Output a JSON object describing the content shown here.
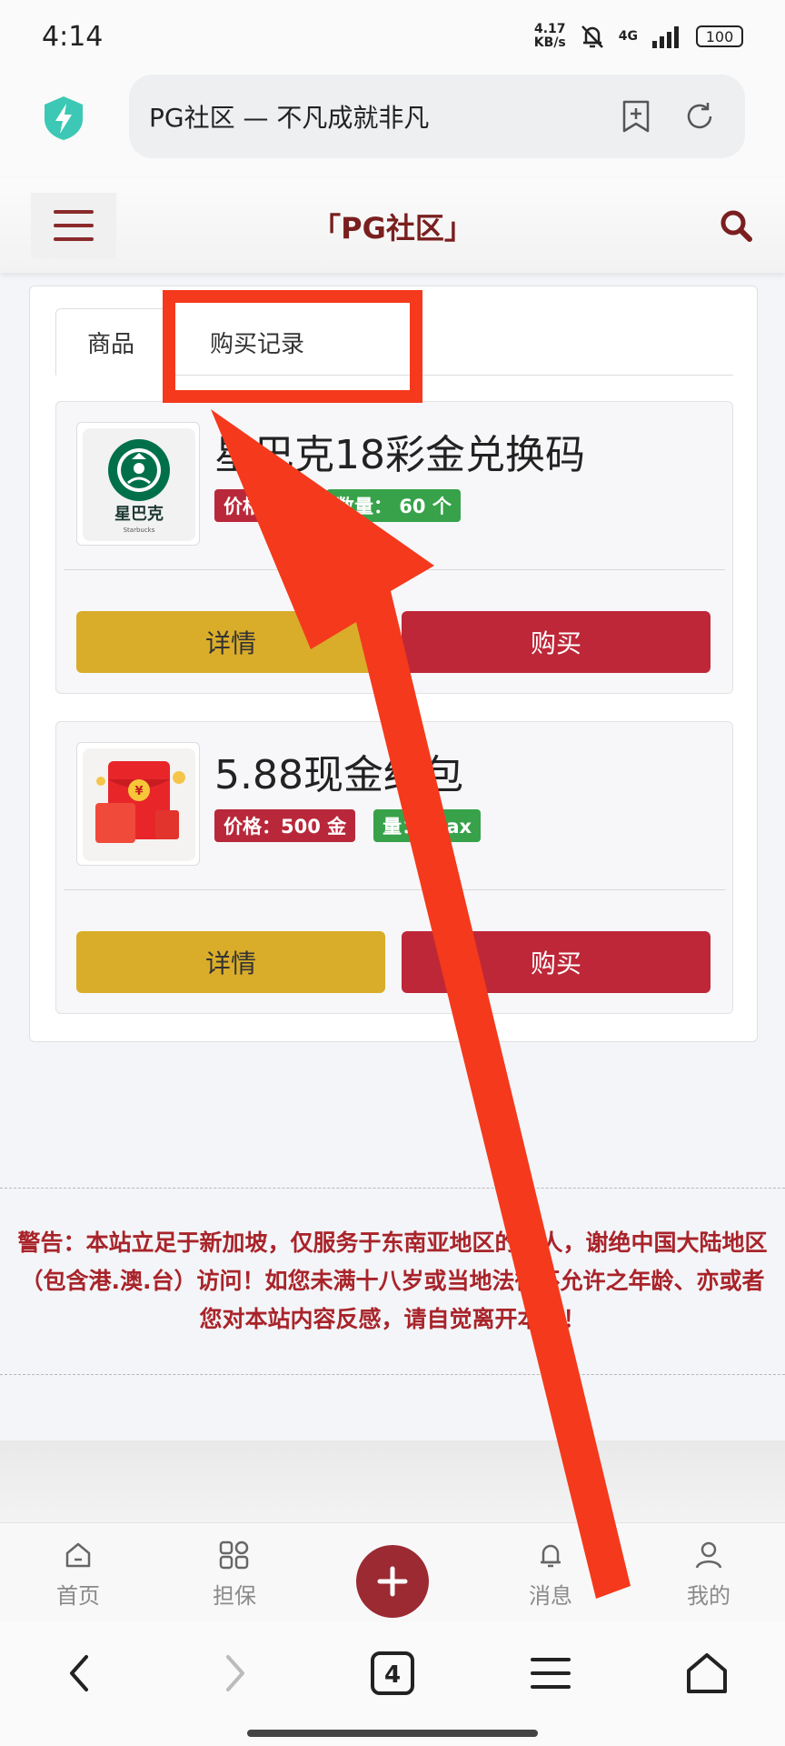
{
  "status_bar": {
    "time": "4:14",
    "net_speed_value": "4.17",
    "net_speed_unit": "KB/s",
    "signal": "4G",
    "battery": "100"
  },
  "browser": {
    "url_text": "PG社区 — 不凡成就非凡",
    "tab_count": "4"
  },
  "site": {
    "title": "「PG社区」"
  },
  "tabs": [
    {
      "label": "商品"
    },
    {
      "label": "购买记录"
    }
  ],
  "products": [
    {
      "name": "星巴克18彩金兑换码",
      "price_badge": "价格：",
      "qty_badge": "数量：  60 个",
      "detail_label": "详情",
      "buy_label": "购买",
      "thumb_text": "星巴克",
      "thumb_subtext": "Starbucks"
    },
    {
      "name": "5.88现金红包",
      "price_badge": "价格：500 金",
      "qty_badge": "量：  Max",
      "detail_label": "详情",
      "buy_label": "购买"
    }
  ],
  "warning": "警告：本站立足于新加坡，仅服务于东南亚地区的华人，谢绝中国大陆地区（包含港.澳.台）访问！如您未满十八岁或当地法律不允许之年龄、亦或者您对本站内容反感，请自觉离开本站！",
  "bottom_nav": [
    {
      "label": "首页",
      "icon": "home-icon"
    },
    {
      "label": "担保",
      "icon": "apps-icon"
    },
    {
      "label": "消息",
      "icon": "bell-icon"
    },
    {
      "label": "我的",
      "icon": "user-icon"
    }
  ],
  "colors": {
    "brand": "#7a1f1f",
    "buy": "#be2738",
    "detail": "#d9ac2a",
    "qty": "#38a24a",
    "annotation": "#f5391c"
  }
}
